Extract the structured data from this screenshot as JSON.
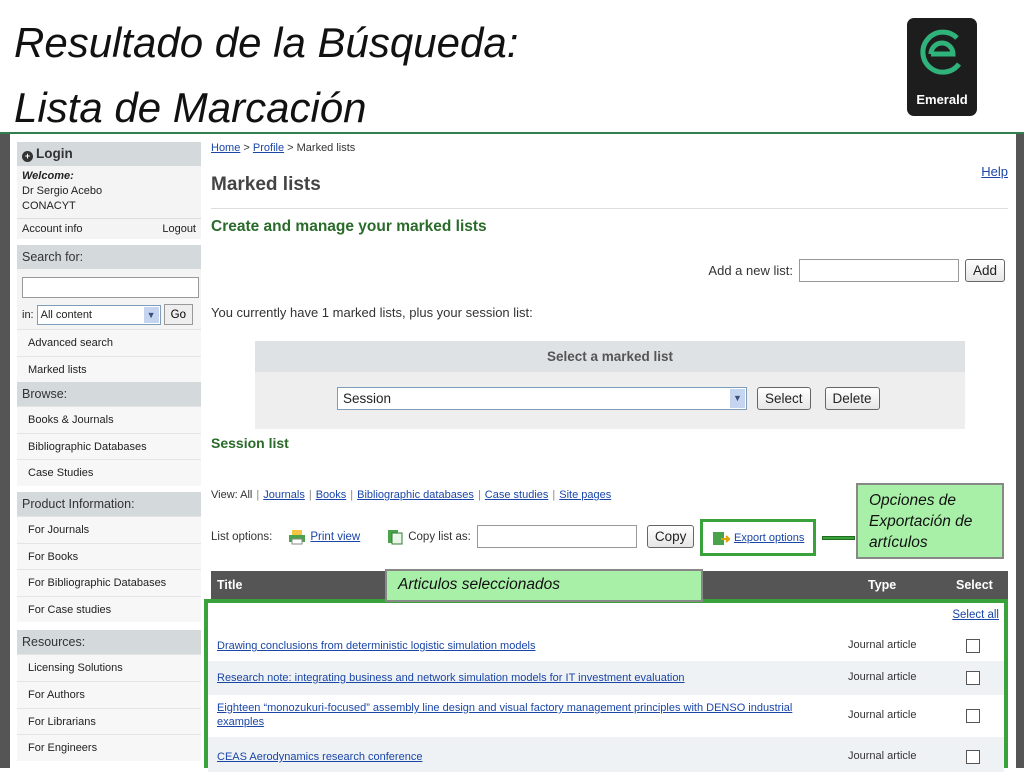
{
  "slide": {
    "title_line1": "Resultado de la Búsqueda:",
    "title_line2": "Lista de Marcación",
    "logo_text": "Emerald"
  },
  "sidebar": {
    "login_label": "Login",
    "welcome_label": "Welcome:",
    "user_name": "Dr Sergio Acebo",
    "user_org": "CONACYT",
    "account_info": "Account info",
    "logout": "Logout",
    "search_header": "Search for:",
    "search_value": "",
    "in_label": "in:",
    "scope_selected": "All content",
    "go_label": "Go",
    "search_links": [
      "Advanced search",
      "Marked lists"
    ],
    "browse_header": "Browse:",
    "browse_items": [
      "Books & Journals",
      "Bibliographic Databases",
      "Case Studies"
    ],
    "product_header": "Product Information:",
    "product_items": [
      "For Journals",
      "For Books",
      "For Bibliographic Databases",
      "For Case studies"
    ],
    "resources_header": "Resources:",
    "resources_items": [
      "Licensing Solutions",
      "For Authors",
      "For Librarians",
      "For Engineers"
    ]
  },
  "main": {
    "breadcrumb": {
      "home": "Home",
      "sep1": " > ",
      "profile": "Profile",
      "sep2": " > ",
      "current": "Marked lists"
    },
    "help": "Help",
    "title": "Marked lists",
    "subtitle": "Create and manage your marked lists",
    "add_list_label": "Add a new list:",
    "add_list_value": "",
    "add_button": "Add",
    "count_text": "You currently have 1 marked lists, plus your session list:",
    "select_panel_header": "Select a marked list",
    "selected_list": "Session",
    "select_button": "Select",
    "delete_button": "Delete",
    "session_list_heading": "Session list",
    "view_label": "View:",
    "view_all": "All",
    "view_filters": [
      "Journals",
      "Books",
      "Bibliographic databases",
      "Case studies",
      "Site pages"
    ],
    "list_options_label": "List options:",
    "print_view": "Print view",
    "copy_list_label": "Copy list as:",
    "copy_value": "",
    "copy_button": "Copy",
    "export_options": "Export options",
    "table_headers": {
      "title": "Title",
      "type": "Type",
      "select": "Select"
    },
    "select_all": "Select all",
    "rows": [
      {
        "title": "Drawing conclusions from deterministic logistic simulation models",
        "type": "Journal article"
      },
      {
        "title": "Research note: integrating business and network simulation models for IT investment evaluation",
        "type": "Journal article"
      },
      {
        "title": "Eighteen “monozukuri-focused” assembly line design and visual factory management principles with DENSO industrial examples",
        "type": "Journal article"
      },
      {
        "title": "CEAS Aerodynamics research conference",
        "type": "Journal article"
      }
    ]
  },
  "annotations": {
    "export_callout": "Opciones de Exportación de artículos",
    "selected_callout": "Articulos seleccionados"
  },
  "colors": {
    "accent_green": "#3aa23a",
    "callout_fill": "#a8f0a8",
    "link_blue": "#1a46a8",
    "heading_green": "#2a6a2a"
  }
}
